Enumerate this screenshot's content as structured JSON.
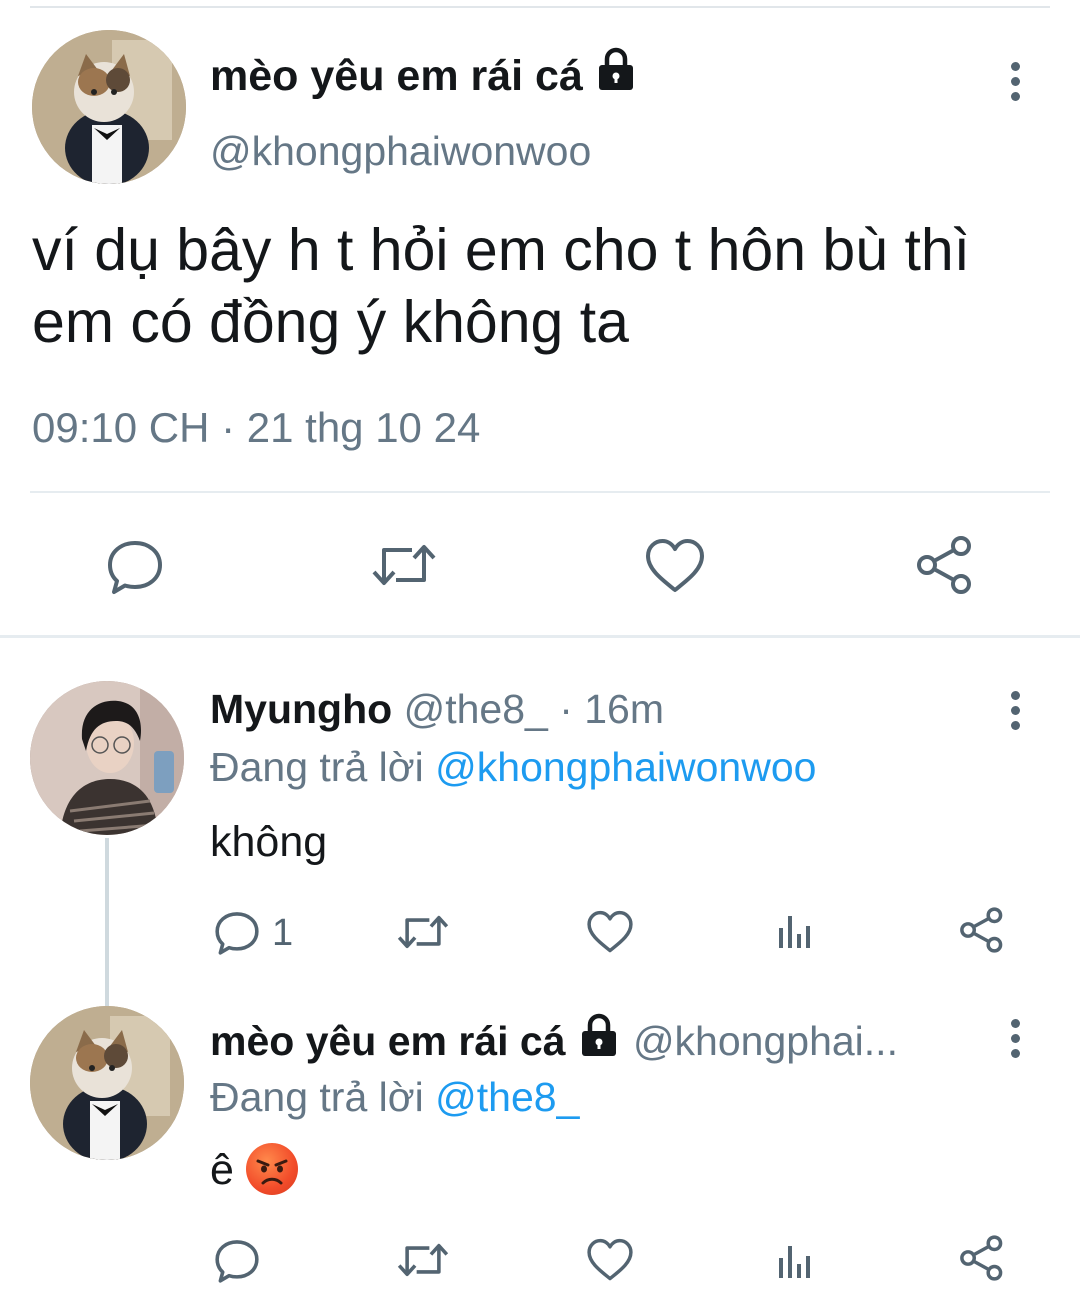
{
  "main": {
    "display_name": "mèo yêu em rái cá",
    "handle": "@khongphaiwonwoo",
    "text": "ví dụ bây h t hỏi em cho t hôn bù thì em có đồng ý không ta",
    "timestamp": "09:10 CH · 21 thg 10 24"
  },
  "replies": [
    {
      "display_name": "Myungho",
      "meta": "@the8_ · 16m",
      "replying_label": "Đang trả lời",
      "replying_to": "@khongphaiwonwoo",
      "text": "không",
      "reply_count": "1"
    },
    {
      "display_name": "mèo yêu em rái cá",
      "meta": "@khongphai...",
      "replying_label": "Đang trả lời",
      "replying_to": "@the8_",
      "text": "ê"
    }
  ],
  "colors": {
    "text": "#14171a",
    "secondary": "#657786",
    "link": "#1d9bf0",
    "divider": "#e6ecf0"
  },
  "icons": {
    "lock": "lock-icon",
    "more": "more-vertical-icon",
    "reply": "reply-icon",
    "retweet": "retweet-icon",
    "like": "heart-icon",
    "views": "analytics-icon",
    "share": "share-icon",
    "emoji": "angry-face-emoji"
  }
}
